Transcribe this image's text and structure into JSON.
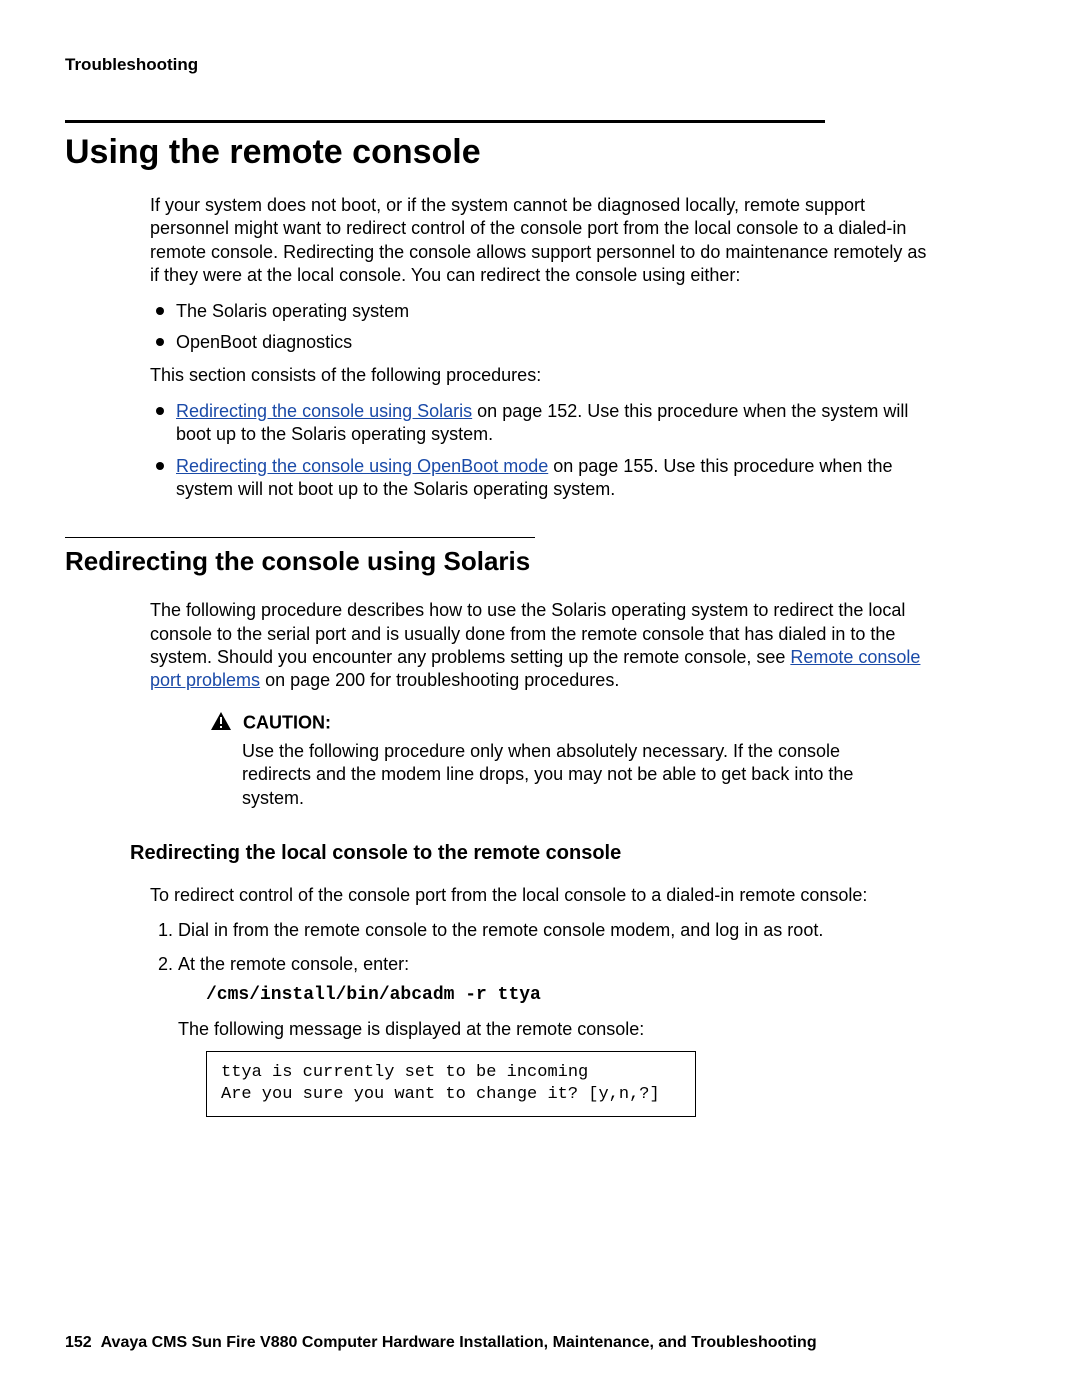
{
  "header": {
    "running": "Troubleshooting"
  },
  "section": {
    "title": "Using the remote console",
    "intro": "If your system does not boot, or if the system cannot be diagnosed locally, remote support personnel might want to redirect control of the console port from the local console to a dialed-in remote console. Redirecting the console allows support personnel to do maintenance remotely as if they were at the local console. You can redirect the console using either:",
    "options": [
      "The Solaris operating system",
      "OpenBoot diagnostics"
    ],
    "procs_intro": "This section consists of the following procedures:",
    "procs": [
      {
        "link": "Redirecting the console using Solaris",
        "tail": " on page 152. Use this procedure when the system will boot up to the Solaris operating system."
      },
      {
        "link": "Redirecting the console using OpenBoot mode",
        "tail": " on page 155. Use this procedure when the system will not boot up to the Solaris operating system."
      }
    ]
  },
  "subsection": {
    "title": "Redirecting the console using Solaris",
    "para_pre": "The following procedure describes how to use the Solaris operating system to redirect the local console to the serial port and is usually done from the remote console that has dialed in to the system. Should you encounter any problems setting up the remote console, see ",
    "para_link": "Remote console port problems",
    "para_post": " on page 200 for troubleshooting procedures.",
    "caution": {
      "label": "CAUTION:",
      "text": "Use the following procedure only when absolutely necessary. If the console redirects and the modem line drops, you may not be able to get back into the system."
    },
    "subsub": {
      "title": "Redirecting the local console to the remote console",
      "intro": "To redirect control of the console port from the local console to a dialed-in remote console:",
      "step1": "Dial in from the remote console to the remote console modem, and log in as root.",
      "step2_lead": "At the remote console, enter:",
      "step2_cmd": "/cms/install/bin/abcadm -r ttya",
      "step2_after": "The following message is displayed at the remote console:",
      "term_output": "ttya is currently set to be incoming\nAre you sure you want to change it? [y,n,?]"
    }
  },
  "footer": {
    "page": "152",
    "title": "Avaya CMS Sun Fire V880 Computer Hardware Installation, Maintenance, and Troubleshooting"
  }
}
